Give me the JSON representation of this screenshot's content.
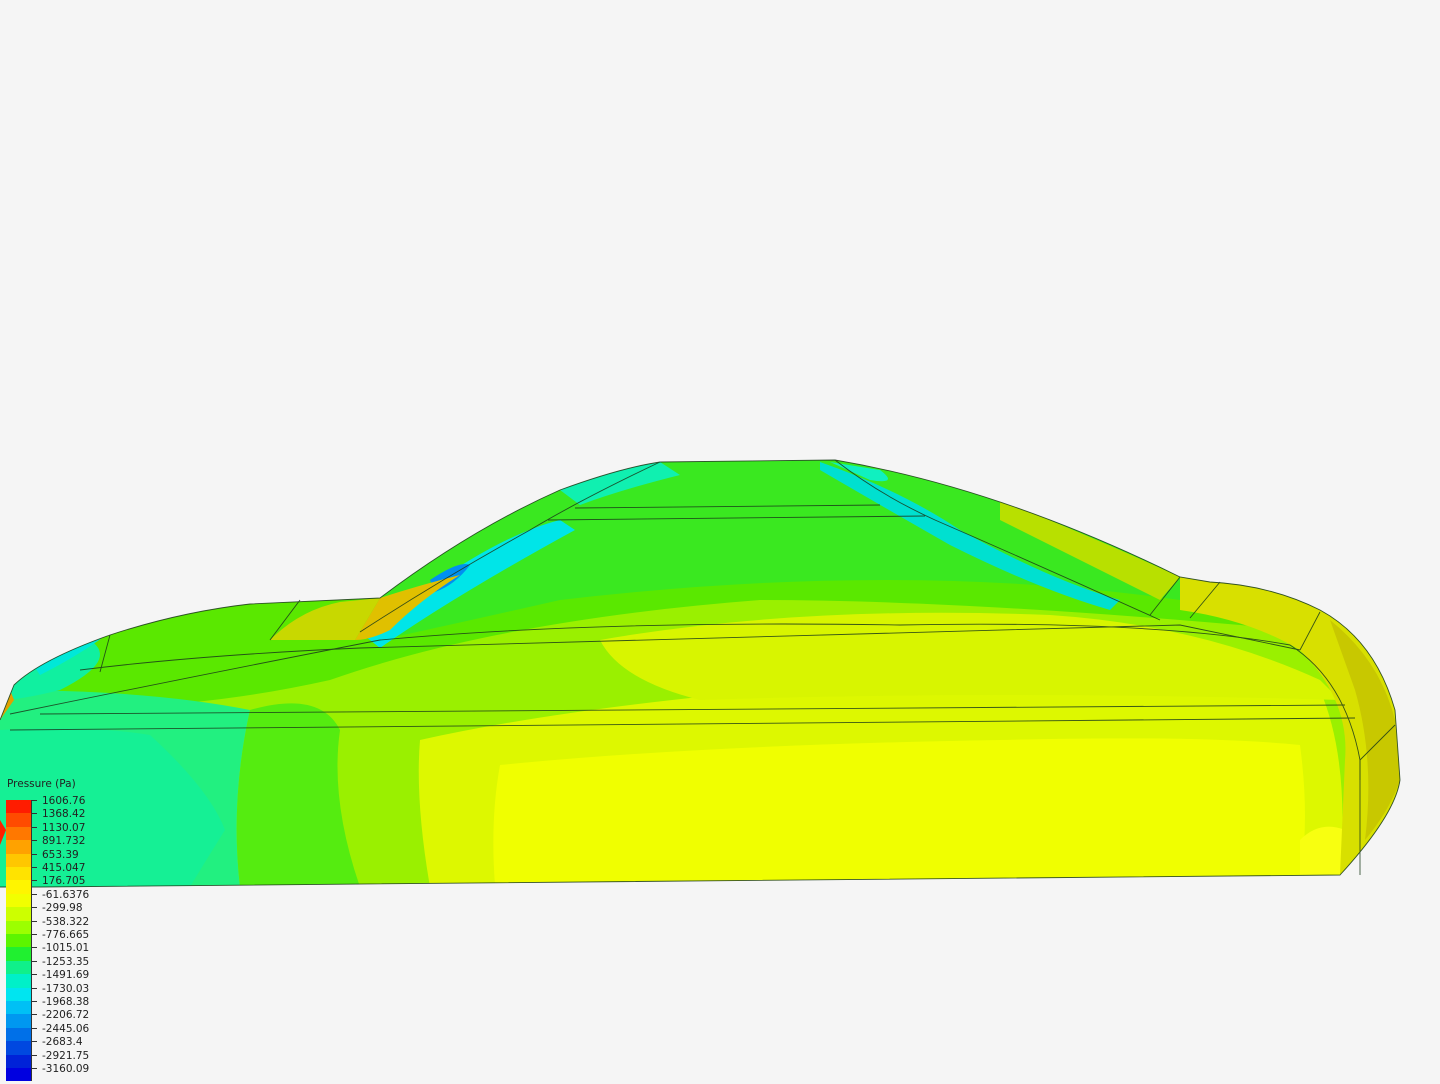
{
  "legend": {
    "title": "Pressure (Pa)",
    "entries": [
      {
        "value": "1606.76",
        "color": "#ff1c00"
      },
      {
        "value": "1368.42",
        "color": "#ff4b00"
      },
      {
        "value": "1130.07",
        "color": "#ff7800"
      },
      {
        "value": "891.732",
        "color": "#ffa200"
      },
      {
        "value": "653.39",
        "color": "#ffc700"
      },
      {
        "value": "415.047",
        "color": "#ffe300"
      },
      {
        "value": "176.705",
        "color": "#fff500"
      },
      {
        "value": "-61.6376",
        "color": "#f2ff00"
      },
      {
        "value": "-299.98",
        "color": "#cdff00"
      },
      {
        "value": "-538.322",
        "color": "#9cff00"
      },
      {
        "value": "-776.665",
        "color": "#5cf500"
      },
      {
        "value": "-1015.01",
        "color": "#20f030"
      },
      {
        "value": "-1253.35",
        "color": "#10f08a"
      },
      {
        "value": "-1491.69",
        "color": "#00f0c8"
      },
      {
        "value": "-1730.03",
        "color": "#00e5f0"
      },
      {
        "value": "-1968.38",
        "color": "#00c0f5"
      },
      {
        "value": "-2206.72",
        "color": "#0098f0"
      },
      {
        "value": "-2445.06",
        "color": "#0070e8"
      },
      {
        "value": "-2683.4",
        "color": "#0048e0"
      },
      {
        "value": "-2921.75",
        "color": "#0022d8"
      },
      {
        "value": "-3160.09",
        "color": "#0000e0"
      }
    ]
  }
}
